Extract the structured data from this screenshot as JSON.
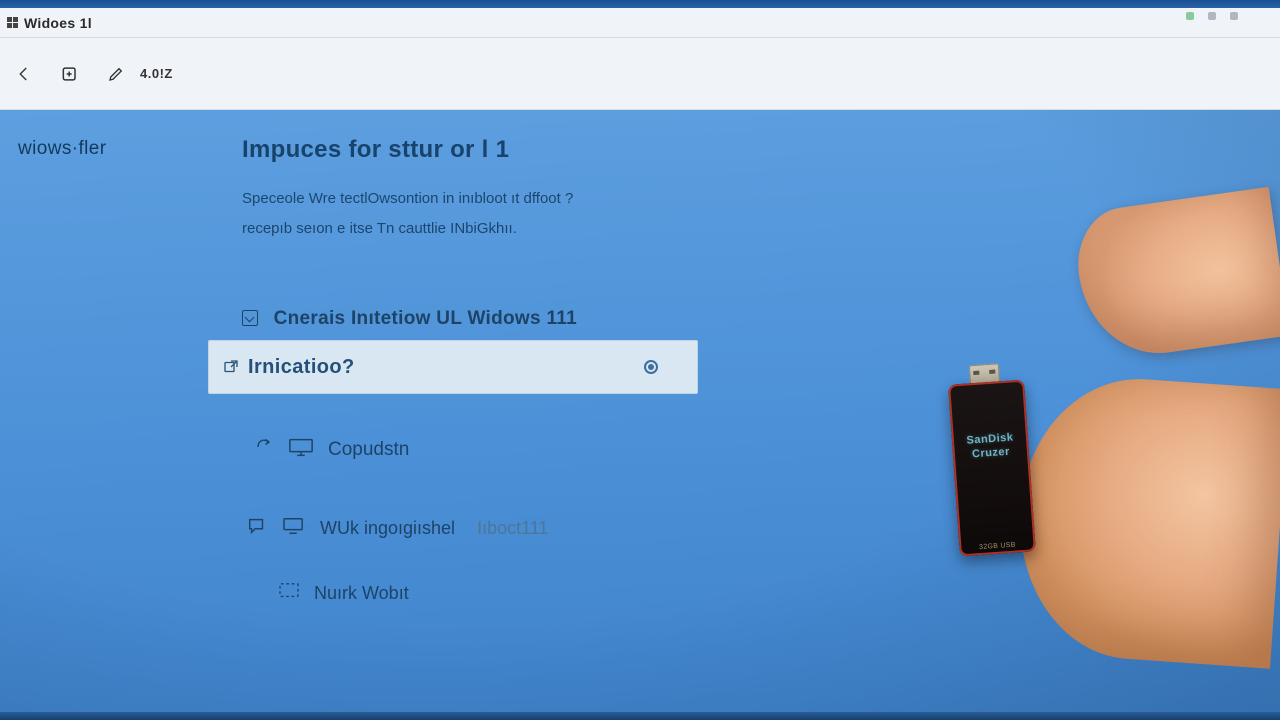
{
  "window": {
    "title": "Widoes 1l"
  },
  "toolbar": {
    "zoom_label": "4.0!Z"
  },
  "tray": {
    "icons": [
      "green",
      "grey",
      "grey"
    ]
  },
  "sidebar": {
    "label": "wiows·fler"
  },
  "page": {
    "heading": "Impuces for sttur or l 1",
    "desc_line1": "Speceole Wre tectlOwsontion in inıbloot ıt dffoot ?",
    "desc_line2": "recepıb seıon e itse Tn cauttlie INbiGkhıı."
  },
  "options": {
    "opt1_label": "Cnerais Inıtetiow UL Widows 111",
    "search_placeholder": "Irnicatioo?",
    "opt2_label": "Copudstn",
    "opt3_label": "WUk ingoıgiıshel",
    "opt3_sub": "Iıboct111",
    "opt4_label": "Nuırk Wobıt"
  },
  "overlay": {
    "usb_brand_top": "SanDisk",
    "usb_brand_bottom": "Cruzer",
    "usb_capacity": "32GB USB"
  }
}
